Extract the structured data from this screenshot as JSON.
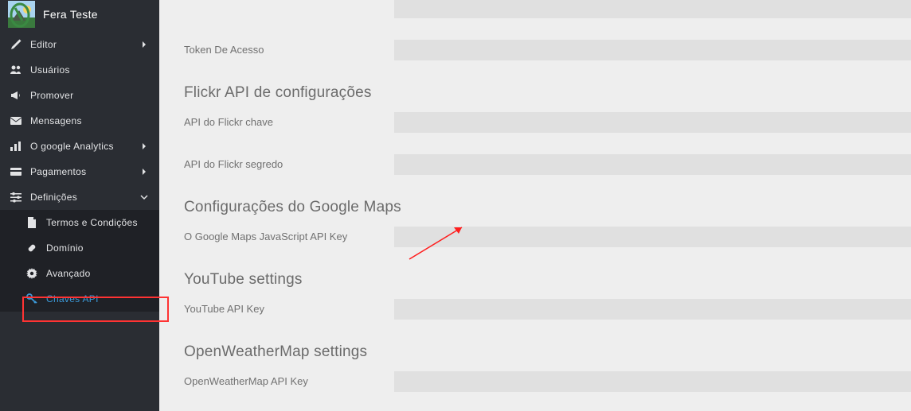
{
  "site": {
    "name": "Fera Teste"
  },
  "nav": {
    "editor": "Editor",
    "usuarios": "Usuários",
    "promover": "Promover",
    "mensagens": "Mensagens",
    "analytics": "O google Analytics",
    "pagamentos": "Pagamentos",
    "definicoes": "Definições"
  },
  "subnav": {
    "termos": "Termos e Condições",
    "dominio": "Domínio",
    "avancado": "Avançado",
    "chaves": "Chaves API"
  },
  "form": {
    "token_acesso": "Token De Acesso",
    "flickr_heading": "Flickr API de configurações",
    "flickr_chave": "API do Flickr chave",
    "flickr_segredo": "API do Flickr segredo",
    "gmaps_heading": "Configurações do Google Maps",
    "gmaps_key": "O Google Maps JavaScript API Key",
    "youtube_heading": "YouTube settings",
    "youtube_key": "YouTube API Key",
    "owm_heading": "OpenWeatherMap settings",
    "owm_key": "OpenWeatherMap API Key"
  }
}
